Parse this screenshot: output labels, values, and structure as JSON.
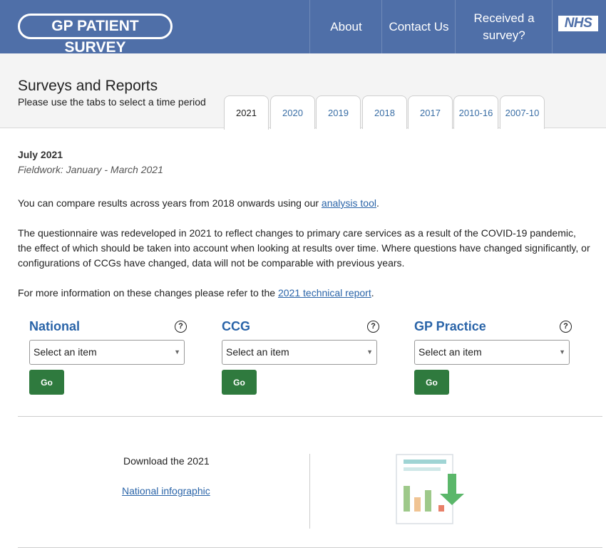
{
  "header": {
    "logo_text": "GP PATIENT SURVEY",
    "nav": {
      "about": "About",
      "contact": "Contact Us",
      "received_line1": "Received a",
      "received_line2": "survey?"
    },
    "nhs_logo": "NHS",
    "colors": {
      "header_bg": "#4f6fa8",
      "link": "#2a64a8",
      "go_button": "#2f7a3e"
    }
  },
  "title_band": {
    "title": "Surveys and Reports",
    "subtitle": "Please use the tabs to select a time period",
    "tabs": [
      {
        "label": "2021",
        "active": true
      },
      {
        "label": "2020",
        "active": false
      },
      {
        "label": "2019",
        "active": false
      },
      {
        "label": "2018",
        "active": false
      },
      {
        "label": "2017",
        "active": false
      },
      {
        "label": "2010-16",
        "active": false
      },
      {
        "label": "2007-10",
        "active": false
      }
    ]
  },
  "content": {
    "date": "July 2021",
    "fieldwork": "Fieldwork: January - March 2021",
    "compare_pre": "You can compare results across years from 2018 onwards using our ",
    "compare_link": "analysis tool",
    "compare_post": ".",
    "redeveloped_line1": "The questionnaire was redeveloped in 2021 to reflect changes to primary care services as a result of the COVID-19 pandemic,",
    "redeveloped_line2": "the effect of which should be taken into account when looking at results over time. Where questions have changed significantly, or",
    "redeveloped_line3": "configurations of CCGs have changed, data will not be comparable with previous years.",
    "more_info_pre": "For more information on these changes please refer to the ",
    "more_info_link": "2021 technical report",
    "more_info_post": "."
  },
  "selectors": [
    {
      "title": "National",
      "help_icon": "?",
      "placeholder": "Select an item",
      "button": "Go"
    },
    {
      "title": "CCG",
      "help_icon": "?",
      "placeholder": "Select an item",
      "button": "Go"
    },
    {
      "title": "GP Practice",
      "help_icon": "?",
      "placeholder": "Select an item",
      "button": "Go"
    }
  ],
  "download": {
    "text": "Download the 2021",
    "link": "National infographic",
    "icon": "infographic-download-icon"
  }
}
